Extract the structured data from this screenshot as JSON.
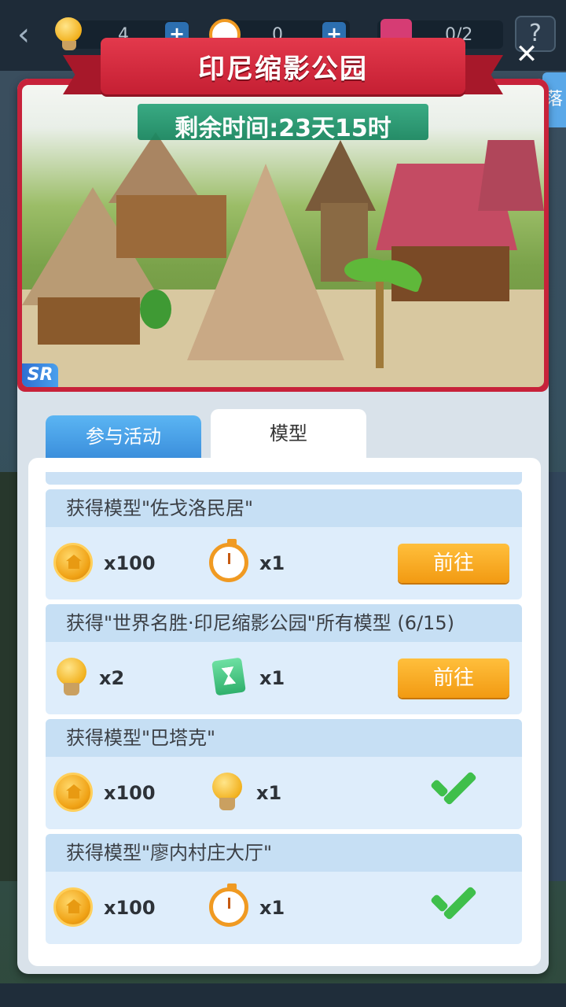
{
  "topbar": {
    "bulb_count": "4",
    "timer_count": "0",
    "gift_count": "0/2",
    "help_label": "?"
  },
  "panel": {
    "title": "印尼缩影公园",
    "remaining_time": "剩余时间:23天15时",
    "rarity": "SR",
    "close_label": "✕",
    "side_tab_peek": "落"
  },
  "tabs": [
    {
      "label": "参与活动",
      "active": false
    },
    {
      "label": "模型",
      "active": true
    }
  ],
  "tasks": [
    {
      "title": "获得模型\"佐戈洛民居\"",
      "rewards": [
        {
          "icon": "coin-icon",
          "amount": "x100"
        },
        {
          "icon": "stopwatch-icon",
          "amount": "x1"
        }
      ],
      "action": "前往",
      "completed": false
    },
    {
      "title": "获得\"世界名胜·印尼缩影公园\"所有模型 (6/15)",
      "rewards": [
        {
          "icon": "lightbulb-icon",
          "amount": "x2"
        },
        {
          "icon": "hourglass-card-icon",
          "amount": "x1"
        }
      ],
      "action": "前往",
      "completed": false
    },
    {
      "title": "获得模型\"巴塔克\"",
      "rewards": [
        {
          "icon": "coin-icon",
          "amount": "x100"
        },
        {
          "icon": "lightbulb-icon",
          "amount": "x1"
        }
      ],
      "action": "",
      "completed": true
    },
    {
      "title": "获得模型\"廖内村庄大厅\"",
      "rewards": [
        {
          "icon": "coin-icon",
          "amount": "x100"
        },
        {
          "icon": "stopwatch-icon",
          "amount": "x1"
        }
      ],
      "action": "",
      "completed": true
    }
  ],
  "colors": {
    "title_ribbon": "#d22b40",
    "timer_bar": "#1e946a",
    "active_tab": "#ffffff",
    "inactive_tab": "#4aa3ea",
    "go_button": "#f5a623",
    "check": "#3fbf4b",
    "card_header": "#c6dff4",
    "card_body": "#deedfb"
  }
}
